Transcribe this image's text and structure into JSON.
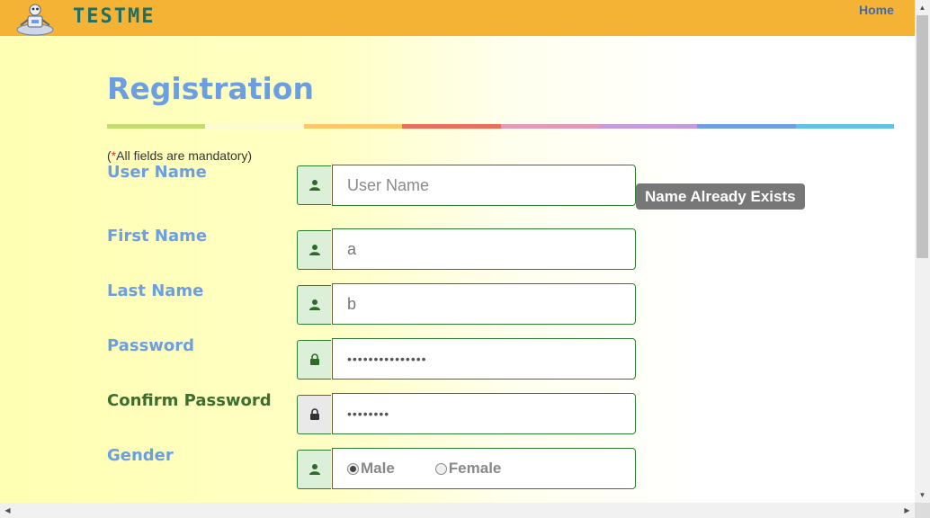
{
  "header": {
    "logo_text": "TESTME",
    "home_link": "Home",
    "colors": {
      "bar": "#f5b335",
      "logo_text": "#1f6f66"
    }
  },
  "page": {
    "title": "Registration",
    "mandatory_star": "*",
    "mandatory_note": "All fields are mandatory)",
    "mandatory_open": "(",
    "rainbow_colors": [
      "#c3de6e",
      "#fbfbd4",
      "#fcc96a",
      "#ec6e5a",
      "#e29ab6",
      "#c79ad8",
      "#6e9fe0",
      "#60c3e2"
    ]
  },
  "form": {
    "username": {
      "label": "User Name",
      "placeholder": "User Name",
      "value": "",
      "icon": "user-icon"
    },
    "tooltip": "Name Already Exists",
    "firstname": {
      "label": "First Name",
      "value": "a",
      "icon": "user-icon"
    },
    "lastname": {
      "label": "Last Name",
      "value": "b",
      "icon": "user-icon"
    },
    "password": {
      "label": "Password",
      "value": "•••••••••••••••",
      "icon": "lock-icon"
    },
    "confirm_password": {
      "label": "Confirm Password",
      "value": "••••••••",
      "icon": "lock-icon"
    },
    "gender": {
      "label": "Gender",
      "options": [
        "Male",
        "Female"
      ],
      "selected": "Male",
      "icon": "user-icon"
    }
  }
}
